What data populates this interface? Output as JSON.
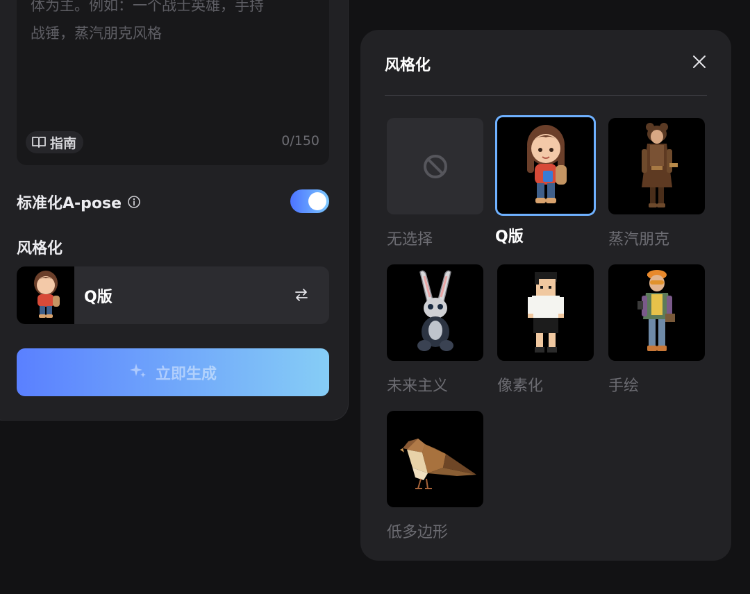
{
  "prompt": {
    "placeholder": "体为主。例如：一个战士英雄，手持\n战锤，蒸汽朋克风格",
    "guide_label": "指南",
    "char_count": "0/150"
  },
  "apose": {
    "label": "标准化A-pose",
    "enabled": true
  },
  "stylize": {
    "heading": "风格化",
    "selected_name": "Q版"
  },
  "generate_button": {
    "label": "立即生成"
  },
  "style_panel": {
    "title": "风格化",
    "options": [
      {
        "label": "无选择",
        "icon": "ban-icon",
        "selected": false
      },
      {
        "label": "Q版",
        "icon": "chibi-girl-figure",
        "selected": true
      },
      {
        "label": "蒸汽朋克",
        "icon": "steampunk-figure",
        "selected": false
      },
      {
        "label": "未来主义",
        "icon": "robot-rabbit-figure",
        "selected": false
      },
      {
        "label": "像素化",
        "icon": "pixel-boy-figure",
        "selected": false
      },
      {
        "label": "手绘",
        "icon": "handdrawn-boy-figure",
        "selected": false
      },
      {
        "label": "低多边形",
        "icon": "lowpoly-bird-figure",
        "selected": false
      }
    ]
  },
  "colors": {
    "background": "#121214",
    "panel": "#222225",
    "accent_start": "#4c73ff",
    "accent_end": "#7cc8ff",
    "selected_border": "#6fb1ff"
  }
}
